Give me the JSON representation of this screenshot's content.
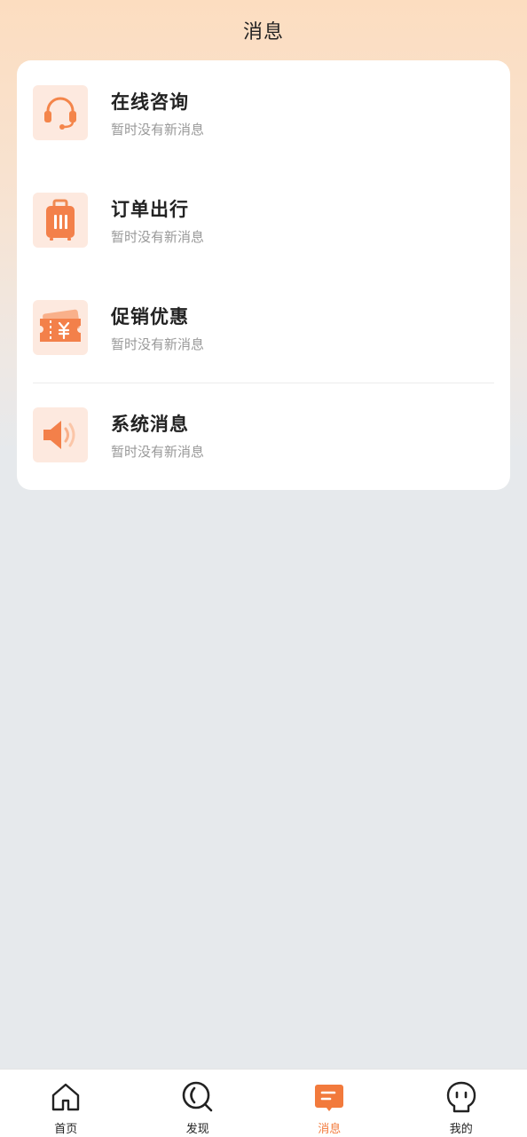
{
  "header": {
    "title": "消息"
  },
  "messages": [
    {
      "title": "在线咨询",
      "subtitle": "暂时没有新消息",
      "icon": "headset-icon"
    },
    {
      "title": "订单出行",
      "subtitle": "暂时没有新消息",
      "icon": "luggage-icon"
    },
    {
      "title": "促销优惠",
      "subtitle": "暂时没有新消息",
      "icon": "coupon-icon"
    },
    {
      "title": "系统消息",
      "subtitle": "暂时没有新消息",
      "icon": "speaker-icon"
    }
  ],
  "tabbar": {
    "active": "消息",
    "items": [
      {
        "label": "首页",
        "icon": "home-icon"
      },
      {
        "label": "发现",
        "icon": "discover-icon"
      },
      {
        "label": "消息",
        "icon": "message-icon"
      },
      {
        "label": "我的",
        "icon": "profile-icon"
      }
    ]
  },
  "colors": {
    "accent": "#f27a3c",
    "icon_bg": "#fde9df",
    "header_gradient_top": "#fcddc0",
    "page_bg": "#e6e9ec"
  }
}
